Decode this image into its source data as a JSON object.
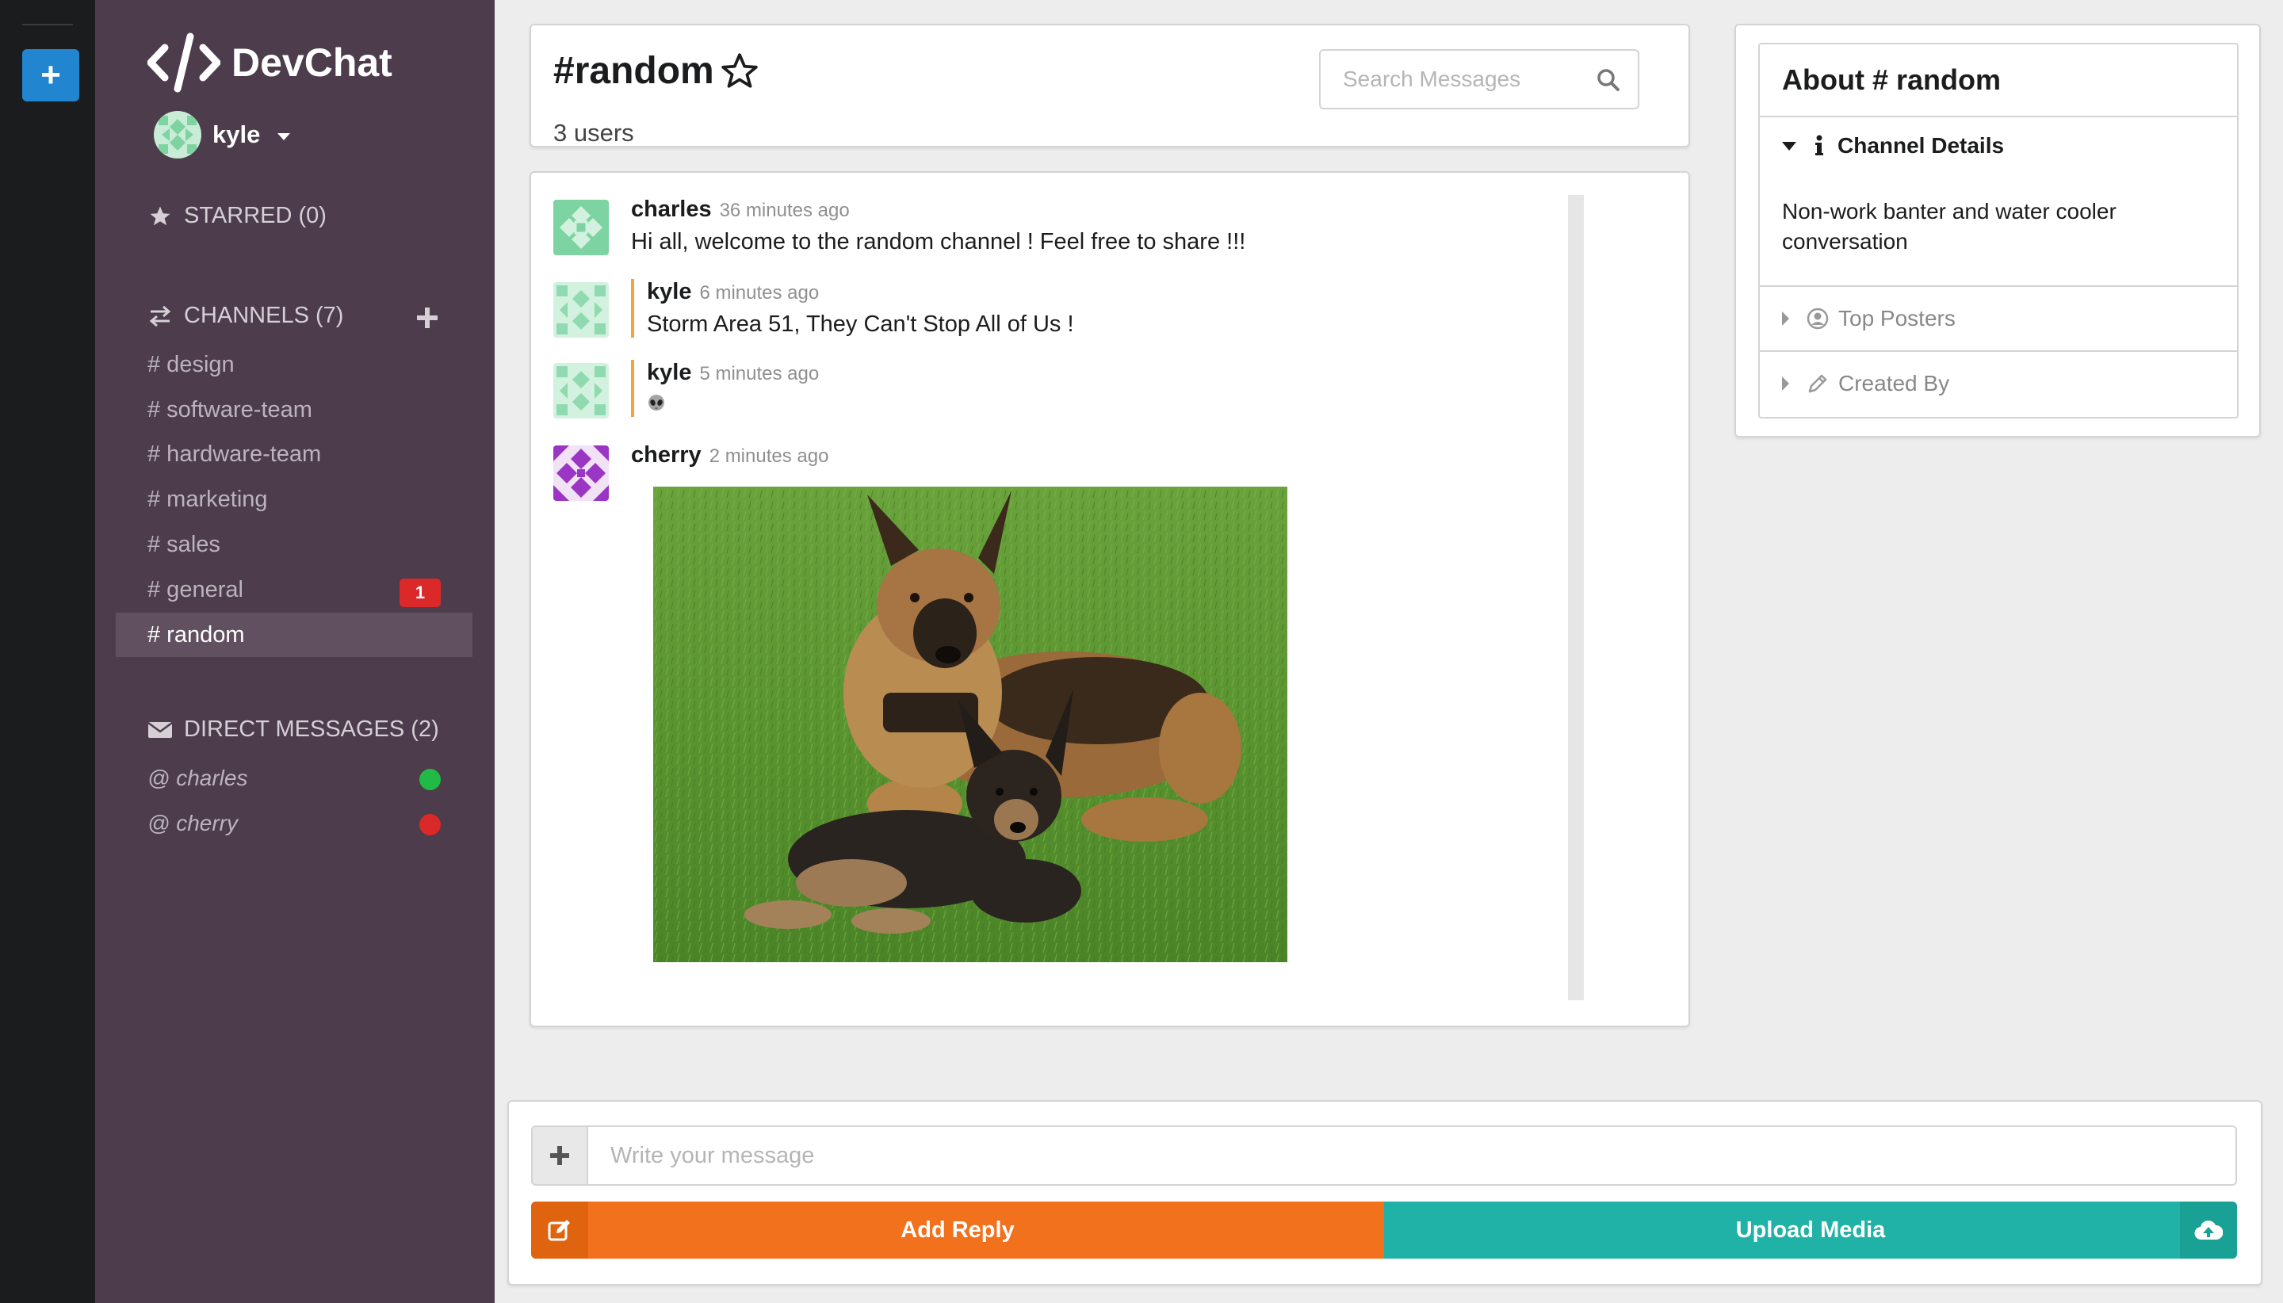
{
  "app": {
    "name": "DevChat"
  },
  "user": {
    "name": "kyle"
  },
  "sidebar": {
    "starred_label": "STARRED (0)",
    "channels_label": "CHANNELS (7)",
    "channels": [
      {
        "label": "# design"
      },
      {
        "label": "# software-team"
      },
      {
        "label": "# hardware-team"
      },
      {
        "label": "# marketing"
      },
      {
        "label": "# sales"
      },
      {
        "label": "# general",
        "badge": "1"
      },
      {
        "label": "# random",
        "active": true
      }
    ],
    "dm_label": "DIRECT MESSAGES (2)",
    "dms": [
      {
        "label": "@ charles",
        "status_color": "#21ba45"
      },
      {
        "label": "@ cherry",
        "status_color": "#db2828"
      }
    ]
  },
  "header": {
    "title": "#random",
    "users": "3 users",
    "search_placeholder": "Search Messages"
  },
  "messages": [
    {
      "author": "charles",
      "time": "36 minutes ago",
      "text": "Hi all, welcome to the random channel ! Feel free to share !!!"
    },
    {
      "author": "kyle",
      "time": "6 minutes ago",
      "text": "Storm Area 51, They Can't Stop All of Us !"
    },
    {
      "author": "kyle",
      "time": "5 minutes ago",
      "text": "",
      "emoji": "alien-icon"
    },
    {
      "author": "cherry",
      "time": "2 minutes ago",
      "text": "",
      "image": "dog-photo"
    }
  ],
  "about": {
    "title": "About # random",
    "details_label": "Channel Details",
    "description": "Non-work banter and water cooler conversation",
    "top_posters_label": "Top Posters",
    "created_by_label": "Created By"
  },
  "composer": {
    "placeholder": "Write your message",
    "reply_label": "Add Reply",
    "upload_label": "Upload Media"
  },
  "colors": {
    "sidebar_bg": "#4c3c4c",
    "rail_bg": "#1b1c1d",
    "accent_blue": "#2185d0",
    "reply_orange": "#f2711c",
    "upload_teal": "#20b2a6",
    "badge_red": "#db2828",
    "online_green": "#21ba45"
  }
}
